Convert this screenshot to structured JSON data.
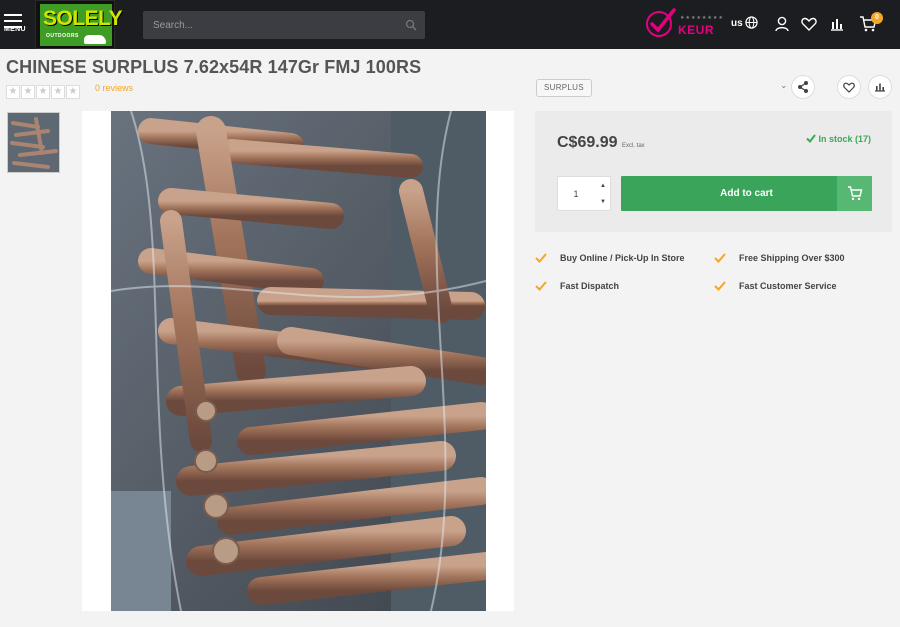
{
  "header": {
    "menu_label": "MENU",
    "logo_text": "SOLELY",
    "logo_subtext": "OUTDOORS",
    "search_placeholder": "Search...",
    "badge_label": "KEUR",
    "region": "us",
    "cart_count": "0"
  },
  "product": {
    "title": "CHINESE SURPLUS 7.62x54R 147Gr FMJ 100RS",
    "rating": 0,
    "max_rating": 5,
    "reviews_label": "0 reviews",
    "tag": "SURPLUS",
    "price": "C$69.99",
    "price_note": "Excl. tax",
    "stock": "In stock (17)",
    "quantity": "1",
    "add_to_cart": "Add to cart"
  },
  "usps": [
    "Buy Online / Pick-Up In Store",
    "Free Shipping Over $300",
    "Fast Dispatch",
    "Fast Customer Service"
  ],
  "colors": {
    "header_bg": "#1c1d21",
    "accent_orange": "#f5a623",
    "cart_green": "#3aa45a",
    "stock_green": "#3aaa55",
    "keur_pink": "#e4007f"
  }
}
